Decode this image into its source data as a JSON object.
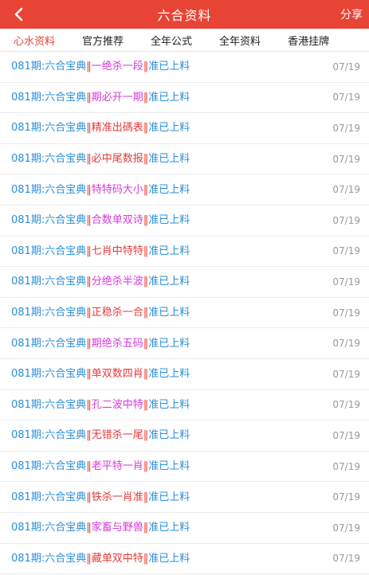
{
  "header": {
    "title": "六合资料",
    "share_label": "分享"
  },
  "tabs": [
    {
      "label": "心水资料",
      "active": true
    },
    {
      "label": "官方推荐",
      "active": false
    },
    {
      "label": "全年公式",
      "active": false
    },
    {
      "label": "全年资料",
      "active": false
    },
    {
      "label": "香港挂牌",
      "active": false
    }
  ],
  "colors": {
    "accent": "#e84435",
    "link_blue": "#2a8fd8",
    "magenta": "#d63adb",
    "red": "#e53b3b",
    "date_gray": "#9a9a9a"
  },
  "list": {
    "items": [
      {
        "prefix": "081期:六合宝典",
        "keyword": "一绝杀一段",
        "suffix": "准已上料",
        "date": "07/19",
        "keyword_color": "magenta"
      },
      {
        "prefix": "081期:六合宝典",
        "keyword": "期必开一期",
        "suffix": "准已上料",
        "date": "07/19",
        "keyword_color": "magenta"
      },
      {
        "prefix": "081期:六合宝典",
        "keyword": "精准出碼表",
        "suffix": "准已上料",
        "date": "07/19",
        "keyword_color": "red"
      },
      {
        "prefix": "081期:六合宝典",
        "keyword": "必中尾数报",
        "suffix": "准已上料",
        "date": "07/19",
        "keyword_color": "red"
      },
      {
        "prefix": "081期:六合宝典",
        "keyword": "特特码大小",
        "suffix": "准已上料",
        "date": "07/19",
        "keyword_color": "magenta"
      },
      {
        "prefix": "081期:六合宝典",
        "keyword": "合数单双诗",
        "suffix": "准已上料",
        "date": "07/19",
        "keyword_color": "magenta"
      },
      {
        "prefix": "081期:六合宝典",
        "keyword": "七肖中特特",
        "suffix": "准已上料",
        "date": "07/19",
        "keyword_color": "red"
      },
      {
        "prefix": "081期:六合宝典",
        "keyword": "分绝杀半波",
        "suffix": "准已上料",
        "date": "07/19",
        "keyword_color": "magenta"
      },
      {
        "prefix": "081期:六合宝典",
        "keyword": "正稳杀一合",
        "suffix": "准已上料",
        "date": "07/19",
        "keyword_color": "red"
      },
      {
        "prefix": "081期:六合宝典",
        "keyword": "期绝杀五码",
        "suffix": "准已上料",
        "date": "07/19",
        "keyword_color": "magenta"
      },
      {
        "prefix": "081期:六合宝典",
        "keyword": "单双数四肖",
        "suffix": "准已上料",
        "date": "07/19",
        "keyword_color": "red"
      },
      {
        "prefix": "081期:六合宝典",
        "keyword": "孔二波中特",
        "suffix": "准已上料",
        "date": "07/19",
        "keyword_color": "magenta"
      },
      {
        "prefix": "081期:六合宝典",
        "keyword": "无错杀一尾",
        "suffix": "准已上料",
        "date": "07/19",
        "keyword_color": "red"
      },
      {
        "prefix": "081期:六合宝典",
        "keyword": "老平特一肖",
        "suffix": "准已上料",
        "date": "07/19",
        "keyword_color": "magenta"
      },
      {
        "prefix": "081期:六合宝典",
        "keyword": "铁杀一肖准",
        "suffix": "准已上料",
        "date": "07/19",
        "keyword_color": "red"
      },
      {
        "prefix": "081期:六合宝典",
        "keyword": "家畜与野兽",
        "suffix": "准已上料",
        "date": "07/19",
        "keyword_color": "magenta"
      },
      {
        "prefix": "081期:六合宝典",
        "keyword": "藏单双中特",
        "suffix": "准已上料",
        "date": "07/19",
        "keyword_color": "red"
      }
    ]
  }
}
